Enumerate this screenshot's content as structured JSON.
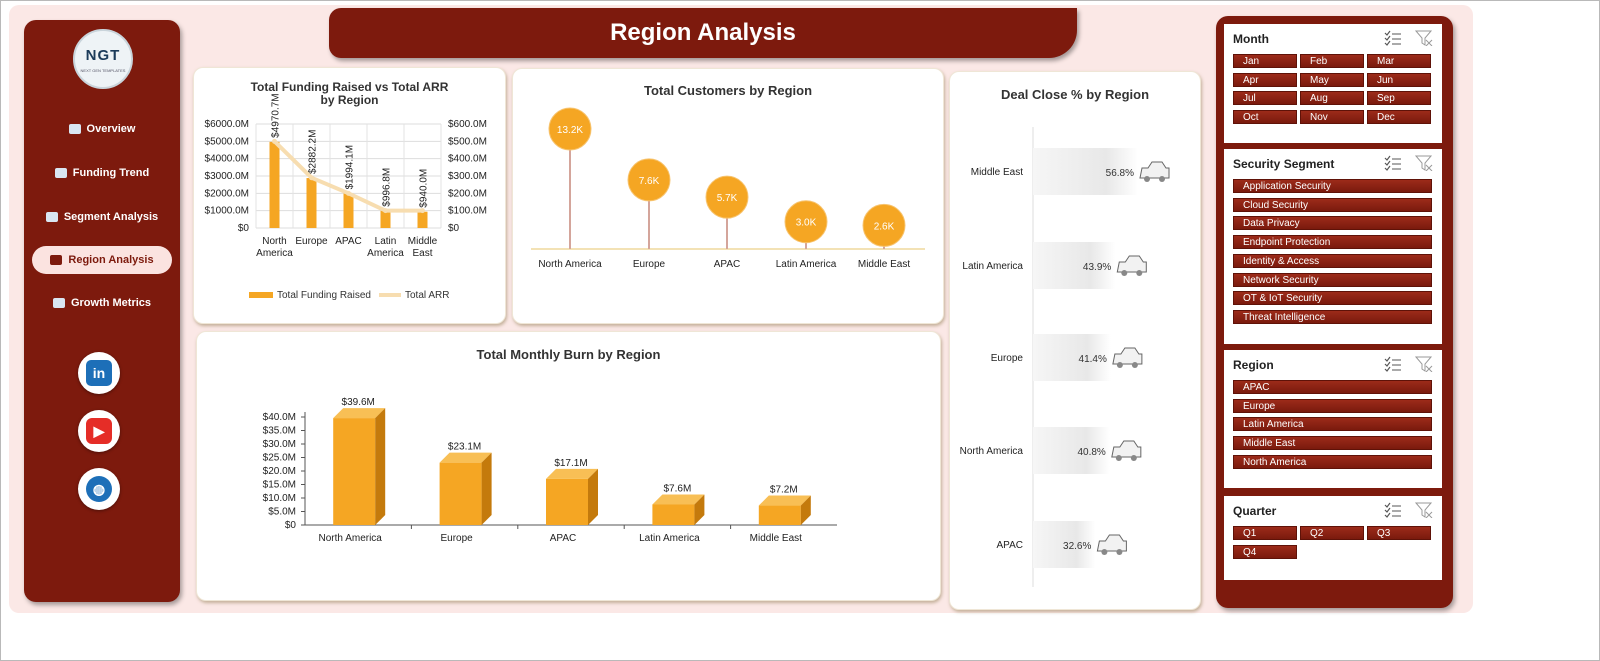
{
  "header": {
    "title": "Region Analysis"
  },
  "logo": {
    "text": "NGT",
    "subtext": "NEXT GEN TEMPLATES"
  },
  "nav": {
    "items": [
      {
        "label": "Overview",
        "icon": "dashboard-icon"
      },
      {
        "label": "Funding Trend",
        "icon": "line-chart-icon"
      },
      {
        "label": "Segment Analysis",
        "icon": "document-icon"
      },
      {
        "label": "Region Analysis",
        "icon": "world-map-icon"
      },
      {
        "label": "Growth Metrics",
        "icon": "folder-icon"
      }
    ],
    "active": "Region Analysis",
    "social": [
      {
        "name": "linkedin-icon",
        "text": "in"
      },
      {
        "name": "youtube-icon",
        "text": "▶"
      },
      {
        "name": "globe-icon",
        "text": "◍"
      }
    ]
  },
  "colors": {
    "brand": "#7d1a0d",
    "bar": "#f5a623",
    "line": "#f7ddb0",
    "background": "#fbe8e6"
  },
  "charts": {
    "funding": {
      "type": "bar",
      "title": "Total Funding Raised vs Total ARR by Region",
      "categories": [
        "North America",
        "Europe",
        "APAC",
        "Latin America",
        "Middle East"
      ],
      "series": [
        {
          "name": "Total Funding Raised",
          "values": [
            4970.7,
            2882.2,
            1994.1,
            996.8,
            940.0
          ],
          "labels": [
            "$4970.7M",
            "$2882.2M",
            "$1994.1M",
            "$996.8M",
            "$940.0M"
          ]
        },
        {
          "name": "Total ARR",
          "values": [
            500,
            290,
            200,
            100,
            100
          ]
        }
      ],
      "y_ticks": [
        "$0",
        "$1000.0M",
        "$2000.0M",
        "$3000.0M",
        "$4000.0M",
        "$5000.0M",
        "$6000.0M"
      ],
      "y2_ticks": [
        "$0",
        "$100.0M",
        "$200.0M",
        "$300.0M",
        "$400.0M",
        "$500.0M",
        "$600.0M"
      ],
      "ylim": [
        0,
        6000
      ],
      "y2lim": [
        0,
        600
      ]
    },
    "customers": {
      "type": "scatter",
      "title": "Total Customers by Region",
      "categories": [
        "North America",
        "Europe",
        "APAC",
        "Latin America",
        "Middle East"
      ],
      "values": [
        13.2,
        7.6,
        5.7,
        3.0,
        2.6
      ],
      "labels": [
        "13.2K",
        "7.6K",
        "5.7K",
        "3.0K",
        "2.6K"
      ]
    },
    "burn": {
      "type": "bar",
      "title": "Total Monthly Burn by Region",
      "categories": [
        "North America",
        "Europe",
        "APAC",
        "Latin America",
        "Middle East"
      ],
      "values": [
        39.6,
        23.1,
        17.1,
        7.6,
        7.2
      ],
      "labels": [
        "$39.6M",
        "$23.1M",
        "$17.1M",
        "$7.6M",
        "$7.2M"
      ],
      "y_ticks": [
        "$0",
        "$5.0M",
        "$10.0M",
        "$15.0M",
        "$20.0M",
        "$25.0M",
        "$30.0M",
        "$35.0M",
        "$40.0M"
      ],
      "ylim": [
        0,
        40
      ]
    },
    "deal": {
      "type": "bar",
      "title": "Deal Close % by Region",
      "categories": [
        "Middle East",
        "Latin America",
        "Europe",
        "North America",
        "APAC"
      ],
      "values": [
        56.8,
        43.9,
        41.4,
        40.8,
        32.6
      ],
      "labels": [
        "56.8%",
        "43.9%",
        "41.4%",
        "40.8%",
        "32.6%"
      ]
    }
  },
  "slicers": [
    {
      "title": "Month",
      "cols": 3,
      "items": [
        "Jan",
        "Feb",
        "Mar",
        "Apr",
        "May",
        "Jun",
        "Jul",
        "Aug",
        "Sep",
        "Oct",
        "Nov",
        "Dec"
      ]
    },
    {
      "title": "Security Segment",
      "cols": 1,
      "items": [
        "Application Security",
        "Cloud Security",
        "Data Privacy",
        "Endpoint Protection",
        "Identity & Access",
        "Network Security",
        "OT & IoT Security",
        "Threat Intelligence"
      ]
    },
    {
      "title": "Region",
      "cols": 1,
      "items": [
        "APAC",
        "Europe",
        "Latin America",
        "Middle East",
        "North America"
      ]
    },
    {
      "title": "Quarter",
      "cols": 3,
      "items": [
        "Q1",
        "Q2",
        "Q3",
        "Q4"
      ]
    }
  ],
  "chart_data": [
    {
      "type": "bar",
      "title": "Total Funding Raised vs Total ARR by Region",
      "categories": [
        "North America",
        "Europe",
        "APAC",
        "Latin America",
        "Middle East"
      ],
      "series": [
        {
          "name": "Total Funding Raised",
          "values": [
            4970.7,
            2882.2,
            1994.1,
            996.8,
            940.0
          ]
        },
        {
          "name": "Total ARR",
          "values": [
            500,
            290,
            200,
            100,
            100
          ]
        }
      ],
      "ylim": [
        0,
        6000
      ],
      "y2lim": [
        0,
        600
      ],
      "grid": true,
      "legend": "bottom"
    },
    {
      "type": "scatter",
      "title": "Total Customers by Region",
      "categories": [
        "North America",
        "Europe",
        "APAC",
        "Latin America",
        "Middle East"
      ],
      "values": [
        13.2,
        7.6,
        5.7,
        3.0,
        2.6
      ]
    },
    {
      "type": "bar",
      "title": "Total Monthly Burn by Region",
      "categories": [
        "North America",
        "Europe",
        "APAC",
        "Latin America",
        "Middle East"
      ],
      "values": [
        39.6,
        23.1,
        17.1,
        7.6,
        7.2
      ],
      "ylim": [
        0,
        40
      ]
    },
    {
      "type": "bar",
      "title": "Deal Close % by Region",
      "categories": [
        "Middle East",
        "Latin America",
        "Europe",
        "North America",
        "APAC"
      ],
      "values": [
        56.8,
        43.9,
        41.4,
        40.8,
        32.6
      ]
    }
  ]
}
